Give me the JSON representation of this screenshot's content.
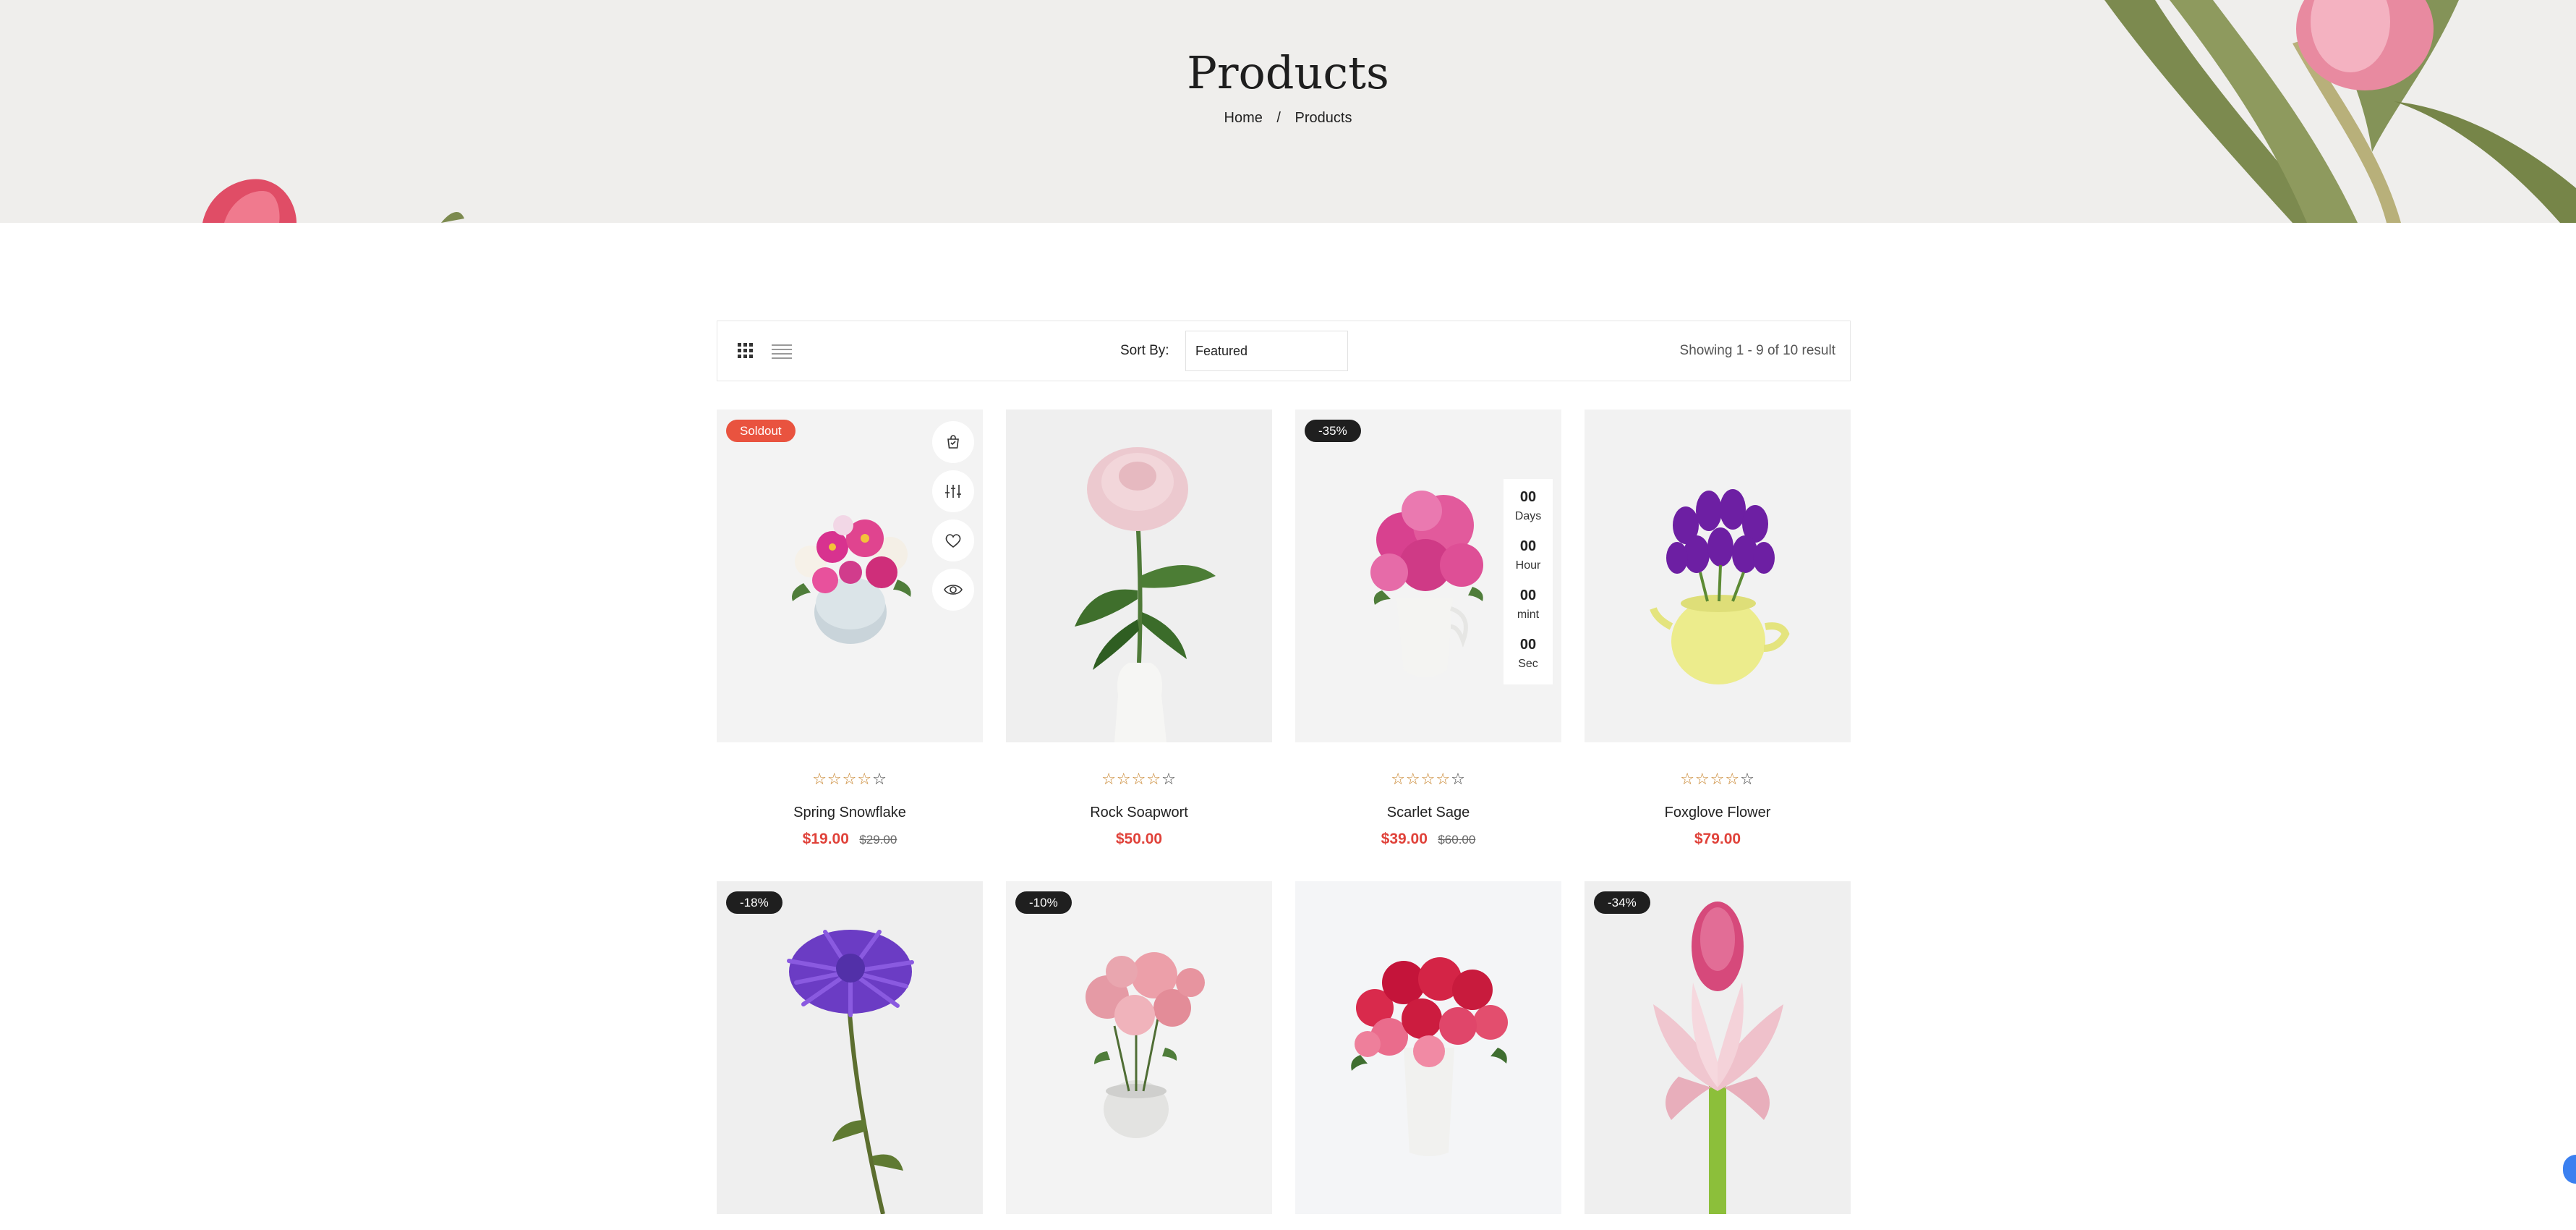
{
  "hero": {
    "title": "Products",
    "breadcrumb": {
      "home": "Home",
      "separator": "/",
      "current": "Products"
    }
  },
  "toolbar": {
    "grid_icon": "grid-icon",
    "list_icon": "list-icon",
    "sort_label": "Sort By:",
    "sort_value": "Featured",
    "showing": "Showing 1 - 9 of 10 result"
  },
  "colors": {
    "accent": "#e0423a",
    "soldout": "#e9533f",
    "badge": "#1f1f1f",
    "star": "#c8842c",
    "hero_bg": "#efeeec"
  },
  "products": [
    {
      "name": "Spring Snowflake",
      "price": "$19.00",
      "old_price": "$29.00",
      "badge": "Soldout",
      "rating": 4
    },
    {
      "name": "Rock Soapwort",
      "price": "$50.00",
      "old_price": "",
      "badge": "",
      "rating": 4
    },
    {
      "name": "Scarlet Sage",
      "price": "$39.00",
      "old_price": "$60.00",
      "badge": "-35%",
      "rating": 4,
      "countdown": [
        {
          "value": "00",
          "label": "Days"
        },
        {
          "value": "00",
          "label": "Hour"
        },
        {
          "value": "00",
          "label": "mint"
        },
        {
          "value": "00",
          "label": "Sec"
        }
      ]
    },
    {
      "name": "Foxglove Flower",
      "price": "$79.00",
      "old_price": "",
      "badge": "",
      "rating": 4
    },
    {
      "badge": "-18%"
    },
    {
      "badge": "-10%"
    },
    {
      "badge": ""
    },
    {
      "badge": "-34%"
    }
  ],
  "card_actions": [
    "cart-icon",
    "compare-icon",
    "heart-icon",
    "eye-icon"
  ]
}
